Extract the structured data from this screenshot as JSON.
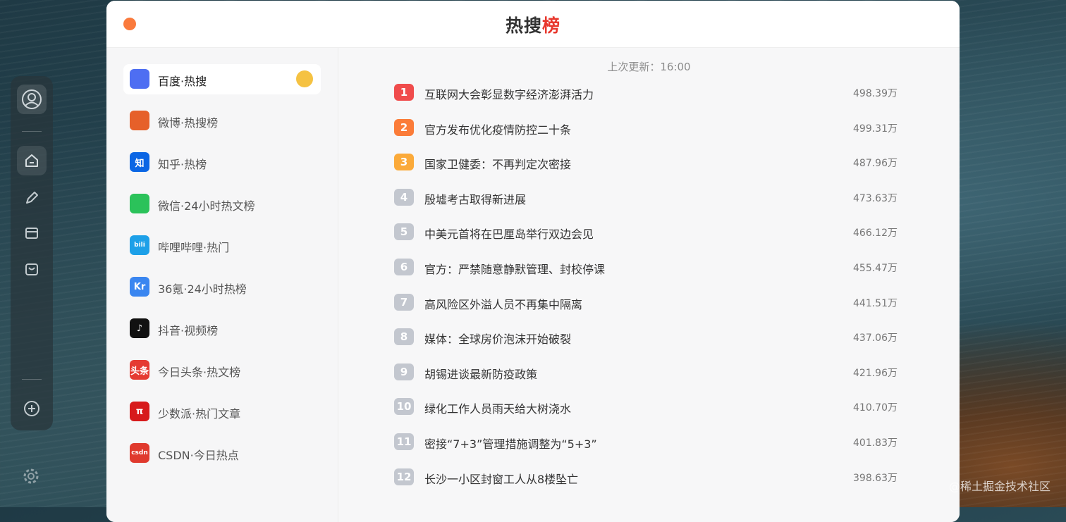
{
  "window": {
    "title_main": "热搜",
    "title_accent": "榜",
    "close_color": "#fa7a3c",
    "accent_color": "#e8382e"
  },
  "dock": {
    "icons": [
      "user-avatar-icon",
      "home-icon",
      "pen-icon",
      "archive-icon",
      "bag-icon",
      "plus-circle-icon",
      "gear-icon"
    ]
  },
  "sources": [
    {
      "label": "百度·热搜",
      "icon": "baidu-icon",
      "glyph": "",
      "color": "#4e6ef2",
      "active": true
    },
    {
      "label": "微博·热搜榜",
      "icon": "weibo-icon",
      "glyph": "",
      "color": "#e6602a",
      "active": false
    },
    {
      "label": "知乎·热榜",
      "icon": "zhihu-icon",
      "glyph": "知",
      "color": "#0b66e4",
      "active": false
    },
    {
      "label": "微信·24小时热文榜",
      "icon": "wechat-icon",
      "glyph": "",
      "color": "#2bc25a",
      "active": false
    },
    {
      "label": "哔哩哔哩·热门",
      "icon": "bilibili-icon",
      "glyph": "bili",
      "color": "#1da0e8",
      "active": false
    },
    {
      "label": "36氪·24小时热榜",
      "icon": "36kr-icon",
      "glyph": "Kr",
      "color": "#3a86f0",
      "active": false
    },
    {
      "label": "抖音·视频榜",
      "icon": "douyin-icon",
      "glyph": "♪",
      "color": "#111111",
      "active": false
    },
    {
      "label": "今日头条·热文榜",
      "icon": "toutiao-icon",
      "glyph": "头条",
      "color": "#e53b32",
      "active": false
    },
    {
      "label": "少数派·热门文章",
      "icon": "sspai-icon",
      "glyph": "π",
      "color": "#d71a1b",
      "active": false
    },
    {
      "label": "CSDN·今日热点",
      "icon": "csdn-icon",
      "glyph": "csdn",
      "color": "#e03a2e",
      "active": false
    }
  ],
  "content": {
    "updated_label": "上次更新：16:00",
    "items": [
      {
        "rank": "1",
        "title": "互联网大会彰显数字经济澎湃活力",
        "heat": "498.39万"
      },
      {
        "rank": "2",
        "title": "官方发布优化疫情防控二十条",
        "heat": "499.31万"
      },
      {
        "rank": "3",
        "title": "国家卫健委：不再判定次密接",
        "heat": "487.96万"
      },
      {
        "rank": "4",
        "title": "殷墟考古取得新进展",
        "heat": "473.63万"
      },
      {
        "rank": "5",
        "title": "中美元首将在巴厘岛举行双边会见",
        "heat": "466.12万"
      },
      {
        "rank": "6",
        "title": "官方：严禁随意静默管理、封校停课",
        "heat": "455.47万"
      },
      {
        "rank": "7",
        "title": "高风险区外溢人员不再集中隔离",
        "heat": "441.51万"
      },
      {
        "rank": "8",
        "title": "媒体：全球房价泡沫开始破裂",
        "heat": "437.06万"
      },
      {
        "rank": "9",
        "title": "胡锡进谈最新防疫政策",
        "heat": "421.96万"
      },
      {
        "rank": "10",
        "title": "绿化工作人员雨天给大树浇水",
        "heat": "410.70万"
      },
      {
        "rank": "11",
        "title": "密接“7+3”管理措施调整为“5+3”",
        "heat": "401.83万"
      },
      {
        "rank": "12",
        "title": "长沙一小区封窗工人从8楼坠亡",
        "heat": "398.63万"
      }
    ]
  },
  "watermark": "@稀土掘金技术社区"
}
